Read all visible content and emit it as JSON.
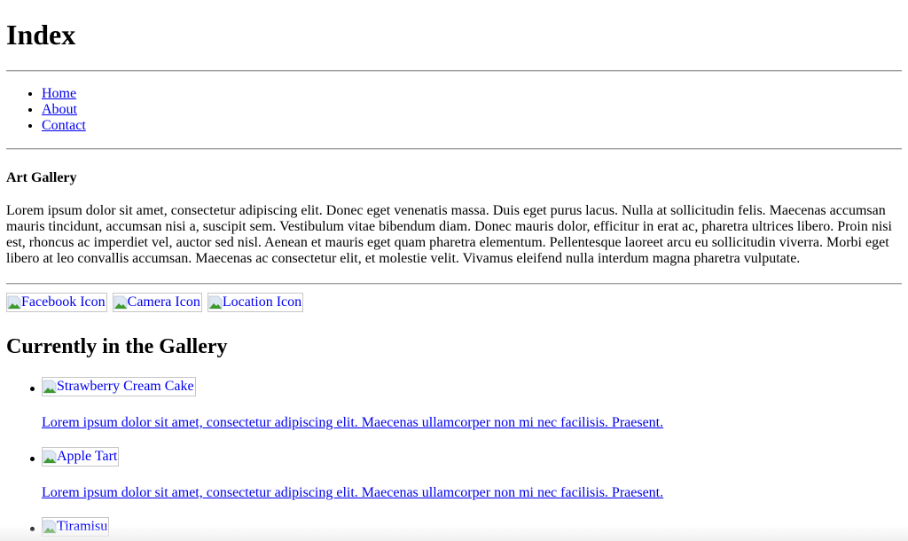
{
  "header": {
    "title": "Index"
  },
  "nav": {
    "items": [
      {
        "label": "Home"
      },
      {
        "label": "About"
      },
      {
        "label": "Contact"
      }
    ]
  },
  "intro": {
    "heading": "Art Gallery",
    "paragraph": "Lorem ipsum dolor sit amet, consectetur adipiscing elit. Donec eget venenatis massa. Duis eget purus lacus. Nulla at sollicitudin felis. Maecenas accumsan mauris tincidunt, accumsan nisi a, suscipit sem. Vestibulum vitae bibendum diam. Donec mauris dolor, efficitur in erat ac, pharetra ultrices libero. Proin nisi est, rhoncus ac imperdiet vel, auctor sed nisl. Aenean et mauris eget quam pharetra elementum. Pellentesque laoreet arcu eu sollicitudin viverra. Morbi eget libero at leo convallis accumsan. Maecenas ac consectetur elit, et molestie velit. Vivamus eleifend nulla interdum magna pharetra vulputate."
  },
  "social_icons": [
    {
      "alt": "Facebook Icon",
      "icon": "broken-image-icon"
    },
    {
      "alt": "Camera Icon",
      "icon": "broken-image-icon"
    },
    {
      "alt": "Location Icon",
      "icon": "broken-image-icon"
    }
  ],
  "gallery": {
    "heading": "Currently in the Gallery",
    "items": [
      {
        "alt": "Strawberry Cream Cake",
        "description": "Lorem ipsum dolor sit amet, consectetur adipiscing elit. Maecenas ullamcorper non mi nec facilisis. Praesent."
      },
      {
        "alt": "Apple Tart",
        "description": "Lorem ipsum dolor sit amet, consectetur adipiscing elit. Maecenas ullamcorper non mi nec facilisis. Praesent."
      },
      {
        "alt": "Tiramisu"
      }
    ]
  }
}
